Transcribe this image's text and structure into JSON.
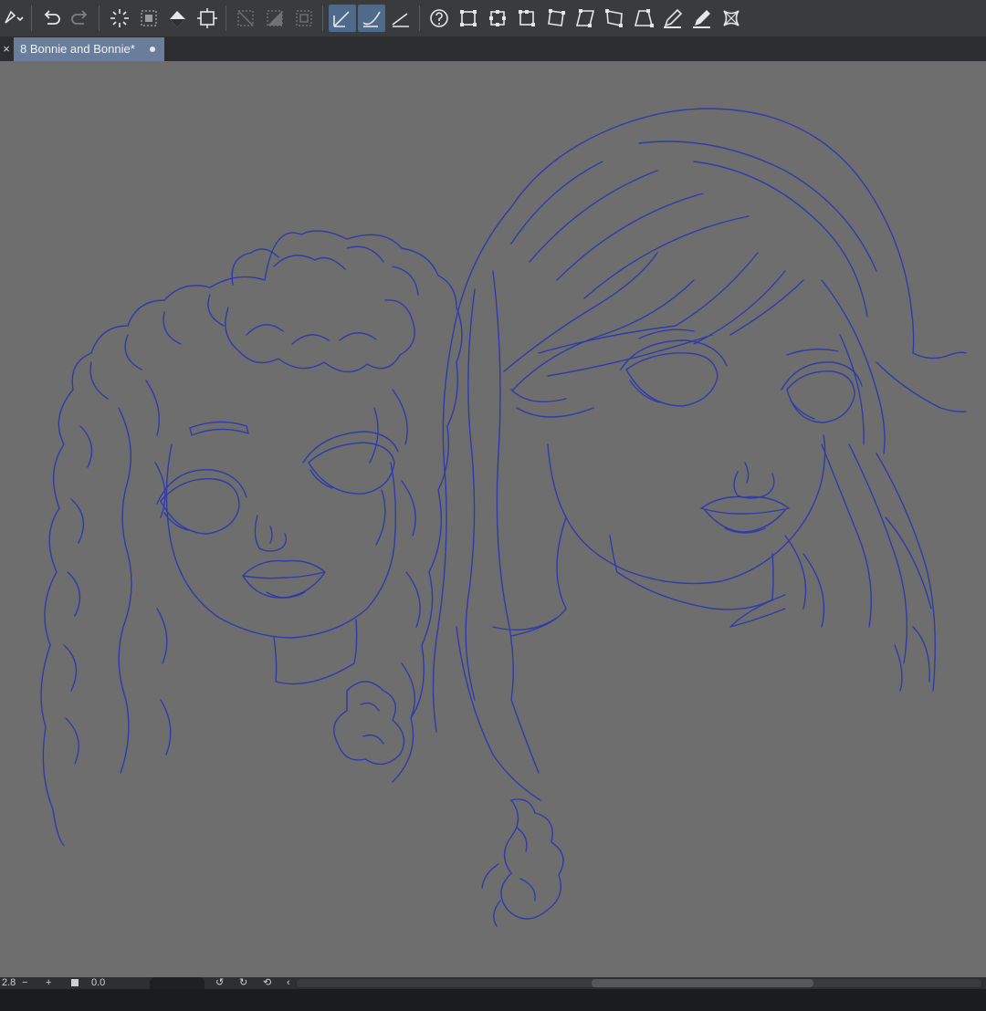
{
  "toolbar": {
    "tools": [
      "brush-dropdown-icon",
      "undo-icon",
      "redo-icon",
      "deselect-icon",
      "select-all-icon",
      "fill-bucket-icon",
      "crop-icon",
      "clear-selection-icon",
      "invert-selection-icon",
      "selection-frame-icon",
      "ruler-snap-icon",
      "curve-snap-icon",
      "line-snap-icon",
      "help-icon",
      "transform-icon",
      "scale-icon",
      "rotate-icon",
      "free-transform-icon",
      "skew-icon",
      "distort-icon",
      "perspective-icon",
      "pen-icon",
      "pen-alt-icon",
      "mesh-transform-icon"
    ],
    "active_tools": [
      "ruler-snap-icon",
      "curve-snap-icon"
    ]
  },
  "tabs": {
    "close_glyph": "×",
    "active_tab": "8 Bonnie and Bonnie*"
  },
  "statusbar": {
    "zoom": "2.8",
    "zoom_out": "−",
    "zoom_in": "+",
    "angle": "0.0"
  },
  "colors": {
    "toolbar_bg": "#3a3b3e",
    "canvas_bg": "#6e6e6e",
    "line_art": "#2a36b0",
    "active_tab": "#6a7d9a",
    "active_tool": "#506a8c"
  }
}
